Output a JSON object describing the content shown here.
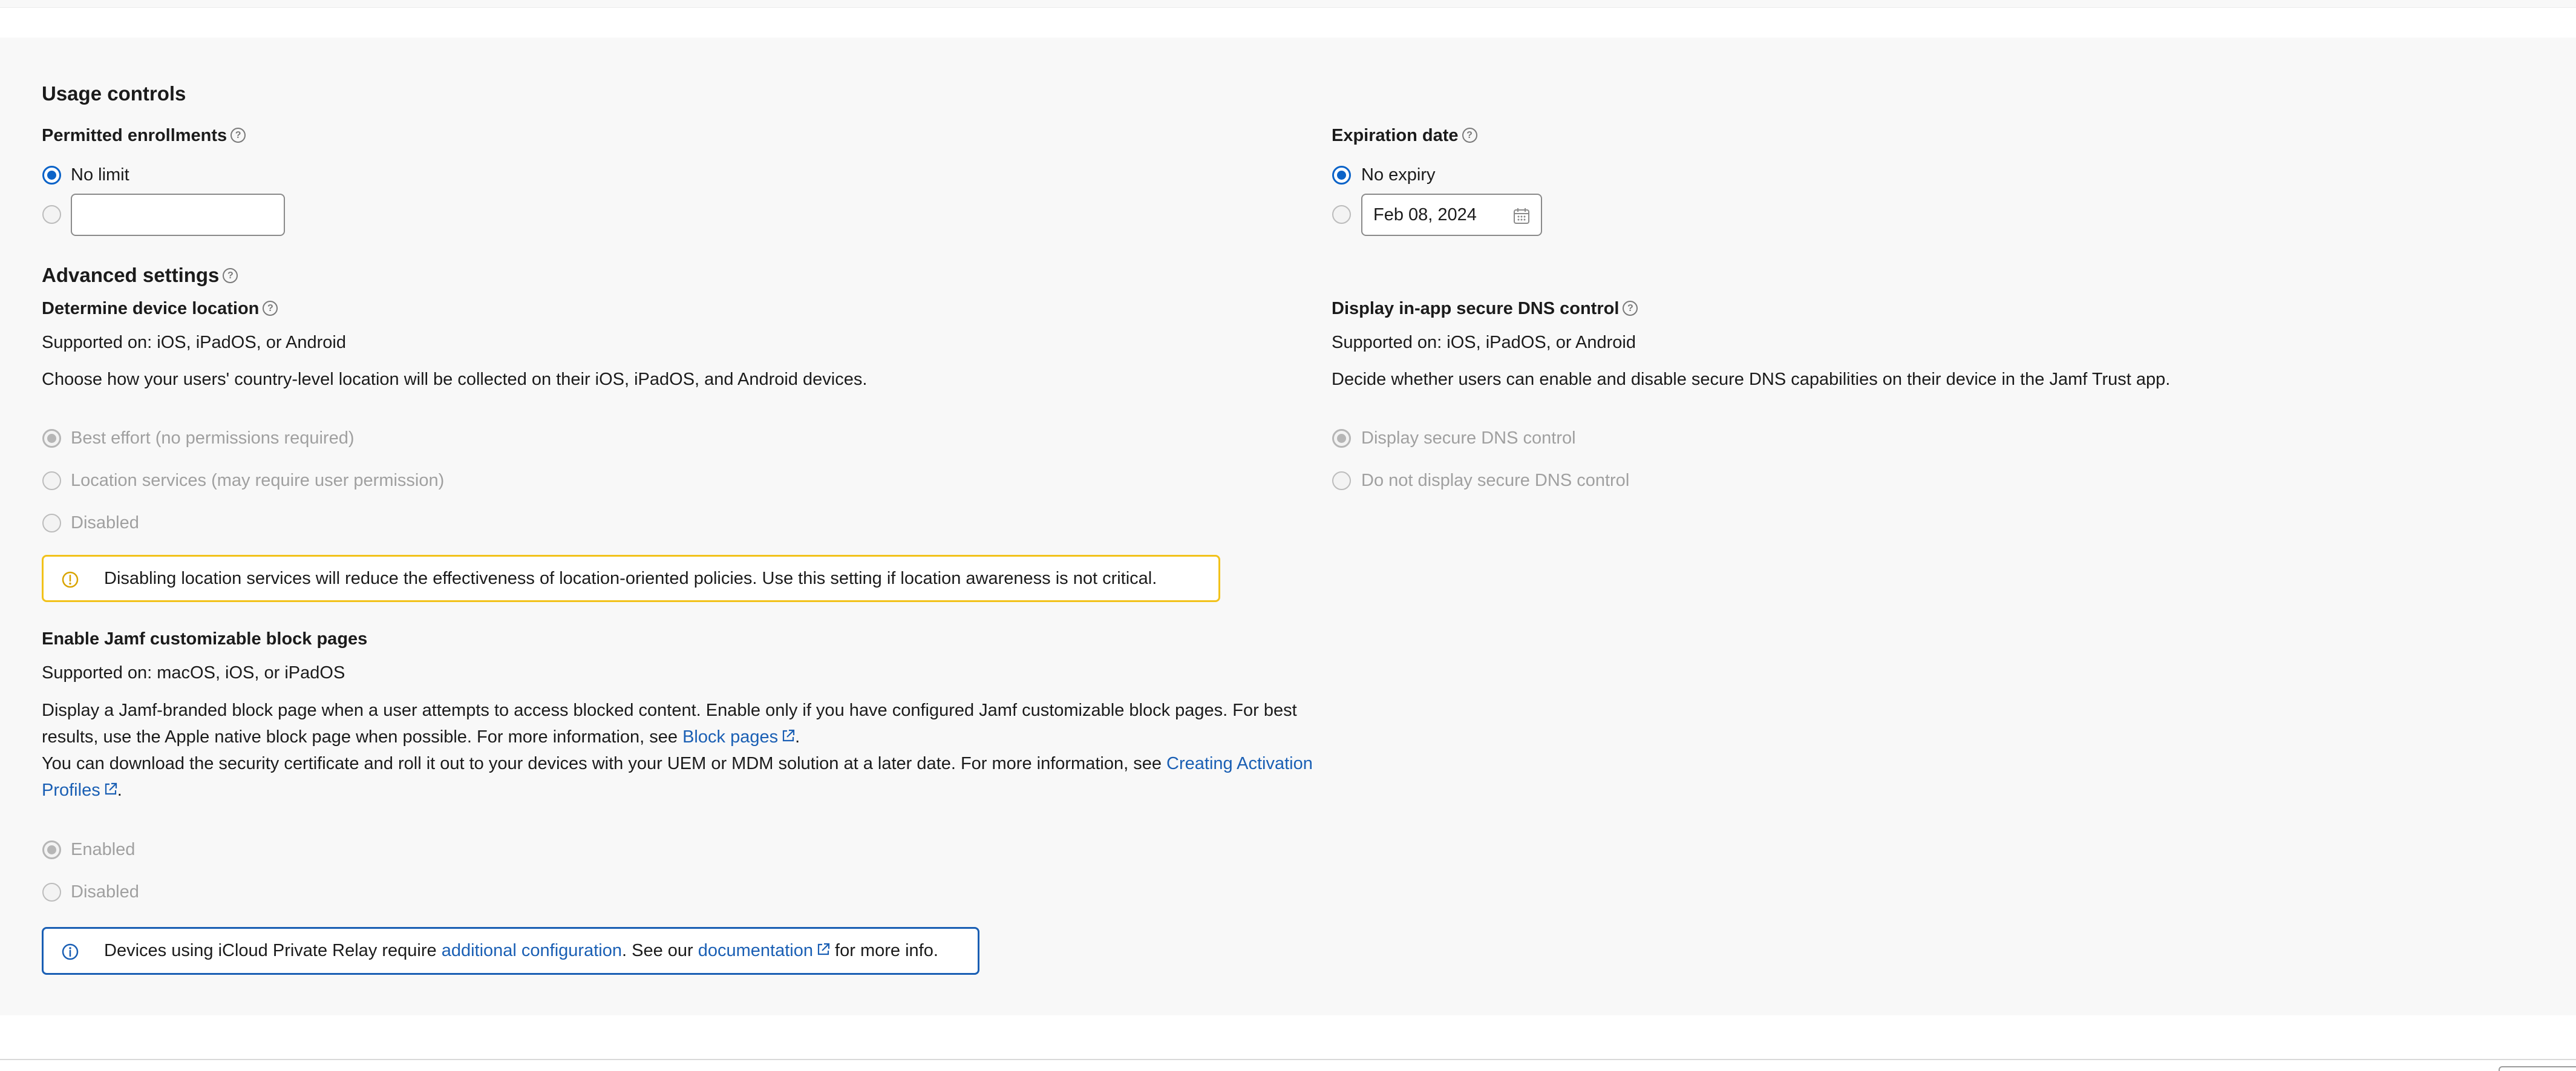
{
  "usage_controls": {
    "title": "Usage controls",
    "permitted_enrollments": {
      "label": "Permitted enrollments",
      "no_limit_label": "No limit",
      "limit_value": ""
    },
    "expiration_date": {
      "label": "Expiration date",
      "no_expiry_label": "No expiry",
      "date_value": "Feb 08, 2024"
    }
  },
  "advanced_settings": {
    "title": "Advanced settings",
    "device_location": {
      "label": "Determine device location",
      "supported": "Supported on: iOS, iPadOS, or Android",
      "description": "Choose how your users' country-level location will be collected on their iOS, iPadOS, and Android devices.",
      "options": [
        "Best effort (no permissions required)",
        "Location services (may require user permission)",
        "Disabled"
      ],
      "selected_index": 0,
      "warning": "Disabling location services will reduce the effectiveness of location-oriented policies. Use this setting if location awareness is not critical."
    },
    "secure_dns": {
      "label": "Display in-app secure DNS control",
      "supported": "Supported on: iOS, iPadOS, or Android",
      "description": "Decide whether users can enable and disable secure DNS capabilities on their device in the Jamf Trust app.",
      "options": [
        "Display secure DNS control",
        "Do not display secure DNS control"
      ],
      "selected_index": 0
    },
    "block_pages": {
      "label": "Enable Jamf customizable block pages",
      "supported": "Supported on: macOS, iOS, or iPadOS",
      "description_1": "Display a Jamf-branded block page when a user attempts to access blocked content. Enable only if you have configured Jamf customizable block pages. For best results, use the Apple native block page when possible. For more information, see ",
      "description_1_link": "Block pages",
      "description_1_end": ".",
      "description_2": "You can download the security certificate and roll it out to your devices with your UEM or MDM solution at a later date. For more information, see ",
      "description_2_link": "Creating Activation Profiles",
      "description_2_end": ".",
      "options": [
        "Enabled",
        "Disabled"
      ],
      "selected_index": 0
    },
    "info_banner": {
      "text_1": "Devices using iCloud Private Relay require ",
      "link_1": "additional configuration",
      "text_2": ". See our ",
      "link_2": "documentation",
      "text_3": " for more info."
    }
  },
  "colors": {
    "accent": "#0b63c8",
    "link": "#1a5fb4",
    "warning_border": "#f2c21b",
    "info_border": "#1a5fb4",
    "panel_bg": "#f8f8f8"
  },
  "icons": {
    "help": "question-circle-icon",
    "external": "external-link-icon",
    "calendar": "calendar-icon",
    "warning": "exclamation-circle-icon",
    "info": "info-circle-icon"
  }
}
